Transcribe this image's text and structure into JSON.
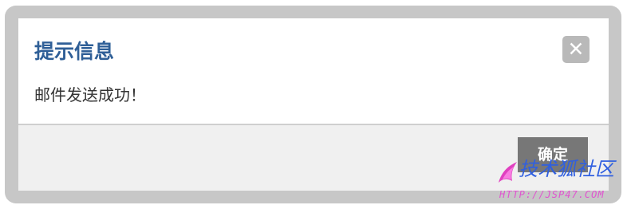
{
  "dialog": {
    "title": "提示信息",
    "close_symbol": "✕",
    "message": "邮件发送成功！",
    "confirm_label": "确定"
  },
  "watermark": {
    "title": "技术狐社区",
    "url": "HTTP://JSP47.COM",
    "logo_icon": "fox-tail-logo"
  },
  "colors": {
    "frame": "#c7c7c7",
    "title": "#2f5f97",
    "close_button": "#b9b9b9",
    "footer": "#f0f0f0",
    "confirm_button": "#777777",
    "watermark_text": "#2f5fe0",
    "watermark_url": "#e055d0"
  }
}
